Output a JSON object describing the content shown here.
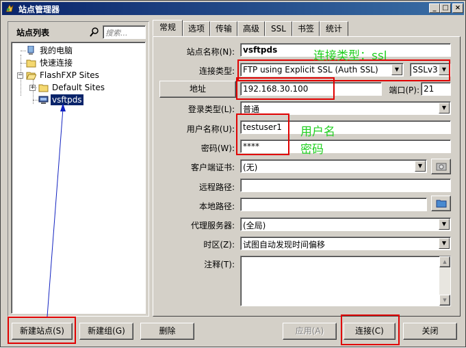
{
  "window": {
    "title": "站点管理器",
    "min": "_",
    "max": "□",
    "close": "×"
  },
  "left": {
    "header": "站点列表",
    "search_placeholder": "搜索...",
    "tree": [
      "我的电脑",
      "快速连接",
      "FlashFXP Sites",
      "Default Sites",
      "vsftpds"
    ]
  },
  "tabs": [
    "常规",
    "选项",
    "传输",
    "高级",
    "SSL",
    "书签",
    "统计"
  ],
  "form": {
    "site_name_label": "站点名称(N):",
    "site_name": "vsftpds",
    "conn_type_label": "连接类型:",
    "conn_type": "FTP using Explicit SSL (Auth SSL)",
    "ssl_ver": "SSLv3",
    "address_btn": "地址",
    "address": "192.168.30.100",
    "port_label": "端口(P):",
    "port": "21",
    "login_type_label": "登录类型(L):",
    "login_type": "普通",
    "username_label": "用户名称(U):",
    "username": "testuser1",
    "password_label": "密码(W):",
    "password": "****",
    "client_cert_label": "客户端证书:",
    "client_cert": "(无)",
    "remote_path_label": "远程路径:",
    "remote_path": "",
    "local_path_label": "本地路径:",
    "local_path": "",
    "proxy_label": "代理服务器:",
    "proxy": "(全局)",
    "timezone_label": "时区(Z):",
    "timezone": "试图自动发现时间偏移",
    "notes_label": "注释(T):",
    "notes": ""
  },
  "buttons": {
    "new_site": "新建站点(S)",
    "new_group": "新建组(G)",
    "delete": "删除",
    "apply": "应用(A)",
    "connect": "连接(C)",
    "close": "关闭"
  },
  "annotations": {
    "conn_type": "连接类型：ssl",
    "username": "用户名",
    "password": "密码"
  },
  "colors": {
    "title_start": "#0a246a",
    "title_end": "#3a6ea5",
    "highlight": "#e00000",
    "annotation": "#20d020"
  }
}
